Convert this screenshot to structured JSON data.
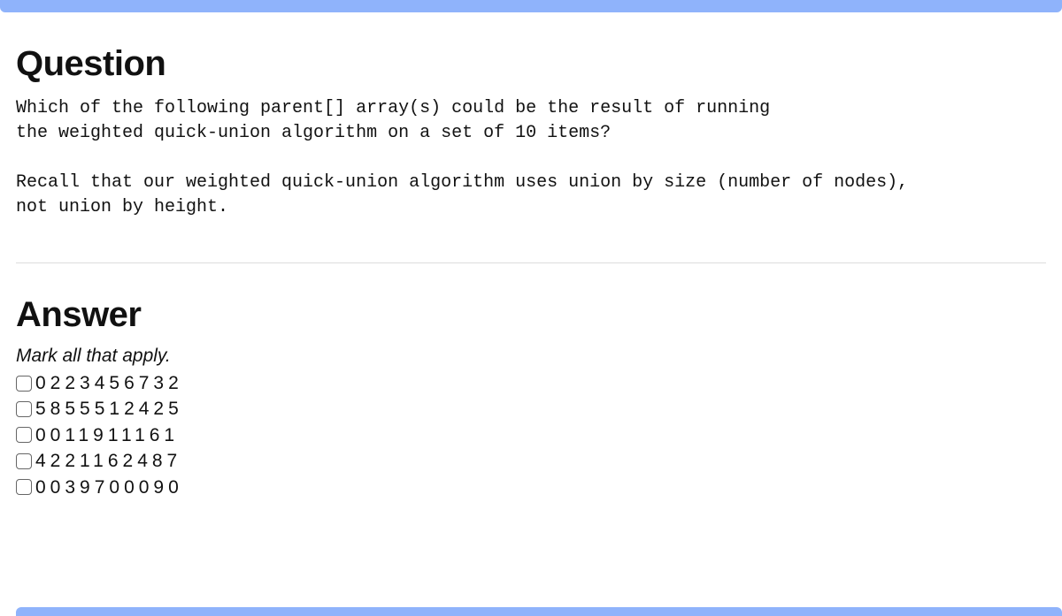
{
  "question": {
    "heading": "Question",
    "body": "Which of the following parent[] array(s) could be the result of running\nthe weighted quick-union algorithm on a set of 10 items?\n\nRecall that our weighted quick-union algorithm uses union by size (number of nodes),\nnot union by height."
  },
  "answer": {
    "heading": "Answer",
    "instruction": "Mark all that apply.",
    "options": [
      "0223456732",
      "5855512425",
      "0011911161",
      "4221162487",
      "0039700090"
    ]
  }
}
